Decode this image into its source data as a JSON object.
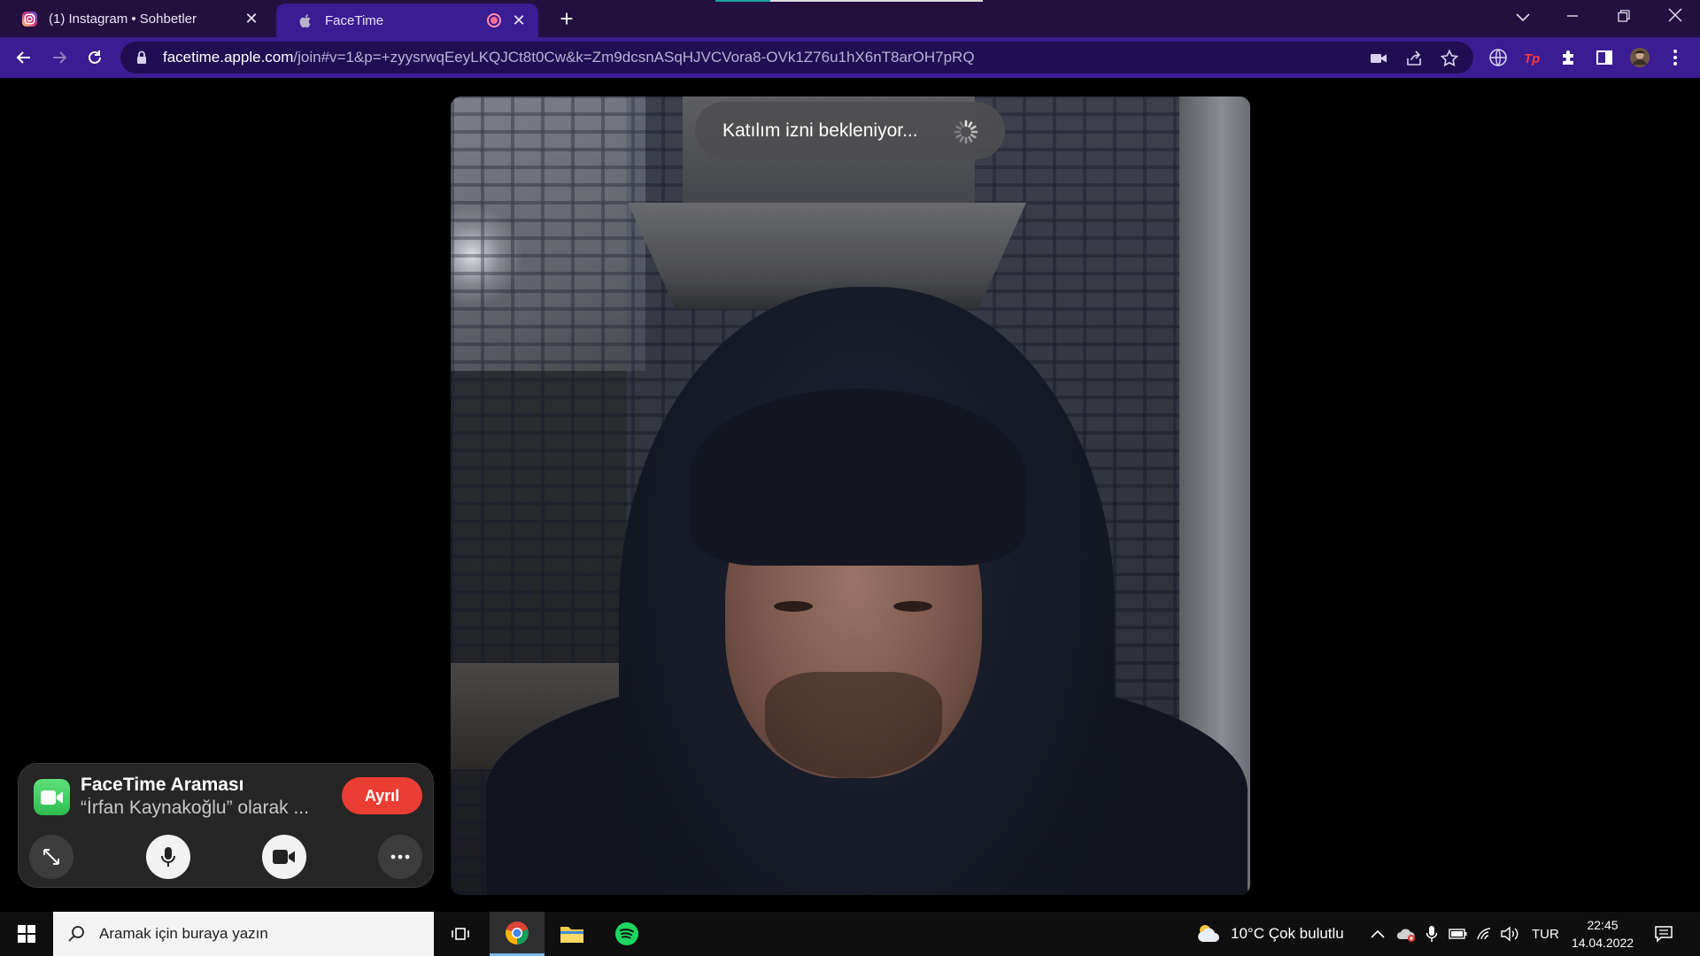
{
  "browser": {
    "tabs": [
      {
        "title": "(1) Instagram • Sohbetler",
        "active": false
      },
      {
        "title": "FaceTime",
        "active": true
      }
    ],
    "new_tab_label": "+",
    "url_host": "facetime.apple.com",
    "url_path": "/join#v=1&p=+zyysrwqEeyLKQJCt8t0Cw&k=Zm9dcsnASqHJVCVora8-OVk1Z76u1hX6nT8arOH7pRQ"
  },
  "video": {
    "status_text": "Katılım izni bekleniyor..."
  },
  "facetime_panel": {
    "title": "FaceTime Araması",
    "subtitle": "“İrfan Kaynakoğlu” olarak ...",
    "leave_label": "Ayrıl",
    "leave_color": "#ea3d33"
  },
  "taskbar": {
    "search_placeholder": "Aramak için buraya yazın",
    "weather": "10°C  Çok bulutlu",
    "language": "TUR",
    "time": "22:45",
    "date": "14.04.2022"
  },
  "colors": {
    "tabstrip": "#23103f",
    "toolbar": "#3a1c93",
    "omnibox": "#1f0f52"
  }
}
